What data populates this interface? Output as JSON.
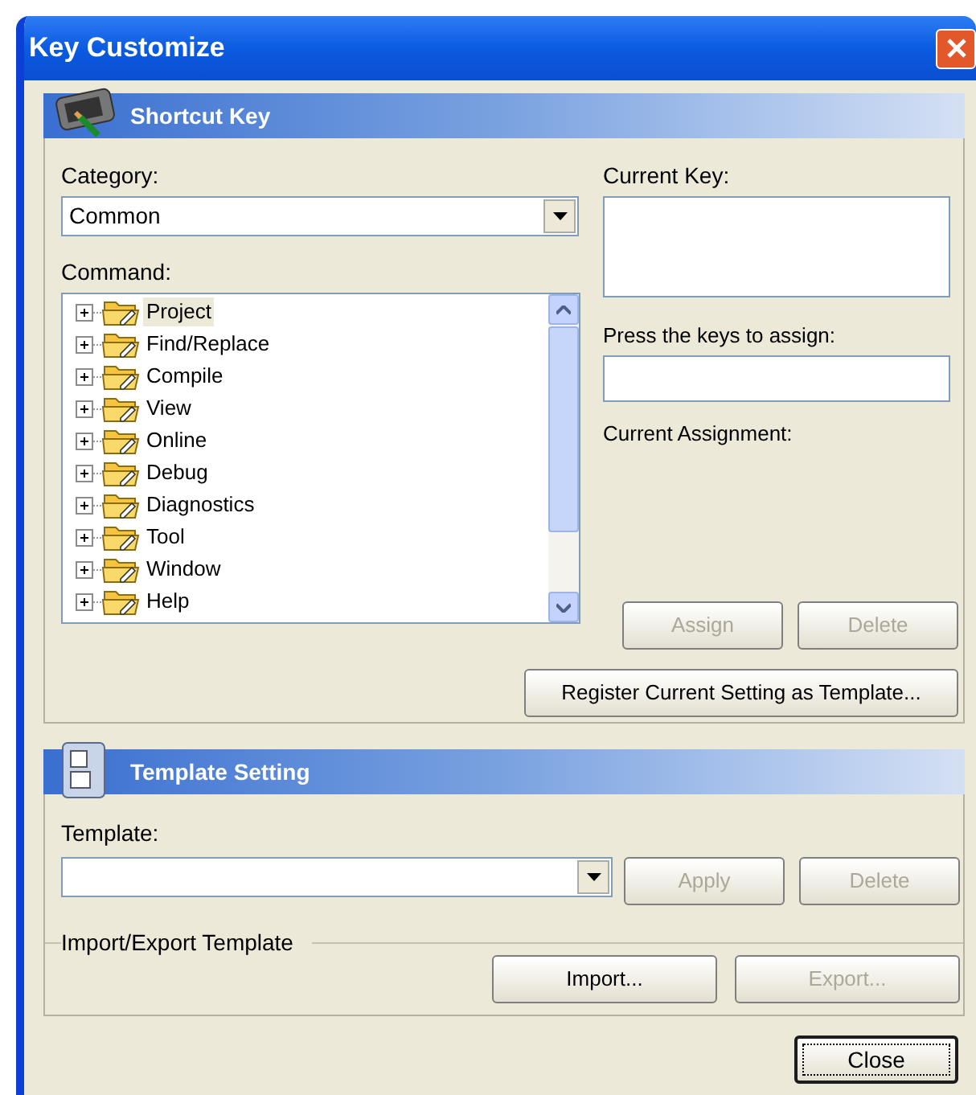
{
  "window": {
    "title": "Key Customize"
  },
  "shortcut_key": {
    "title": "Shortcut Key",
    "category_label": "Category:",
    "category_value": "Common",
    "command_label": "Command:",
    "commands": [
      {
        "label": "Project",
        "expanded": false,
        "selected": true
      },
      {
        "label": "Find/Replace",
        "expanded": false,
        "selected": false
      },
      {
        "label": "Compile",
        "expanded": false,
        "selected": false
      },
      {
        "label": "View",
        "expanded": false,
        "selected": false
      },
      {
        "label": "Online",
        "expanded": false,
        "selected": false
      },
      {
        "label": "Debug",
        "expanded": false,
        "selected": false
      },
      {
        "label": "Diagnostics",
        "expanded": false,
        "selected": false
      },
      {
        "label": "Tool",
        "expanded": false,
        "selected": false
      },
      {
        "label": "Window",
        "expanded": false,
        "selected": false
      },
      {
        "label": "Help",
        "expanded": false,
        "selected": false
      }
    ],
    "current_key_label": "Current Key:",
    "press_keys_label": "Press the keys to assign:",
    "current_assignment_label": "Current Assignment:",
    "buttons": [
      {
        "label": "Assign",
        "disabled": true
      },
      {
        "label": "Delete",
        "disabled": true
      }
    ],
    "register_button": {
      "label": "Register Current Setting as Template...",
      "disabled": false
    }
  },
  "template_setting": {
    "title": "Template Setting",
    "template_label": "Template:",
    "buttons": [
      {
        "label": "Apply",
        "disabled": true
      },
      {
        "label": "Delete",
        "disabled": true
      }
    ],
    "import_export_label": "Import/Export Template",
    "import_export_buttons": [
      {
        "label": "Import...",
        "disabled": false
      },
      {
        "label": "Export...",
        "disabled": true
      }
    ]
  },
  "close_button": {
    "label": "Close"
  }
}
